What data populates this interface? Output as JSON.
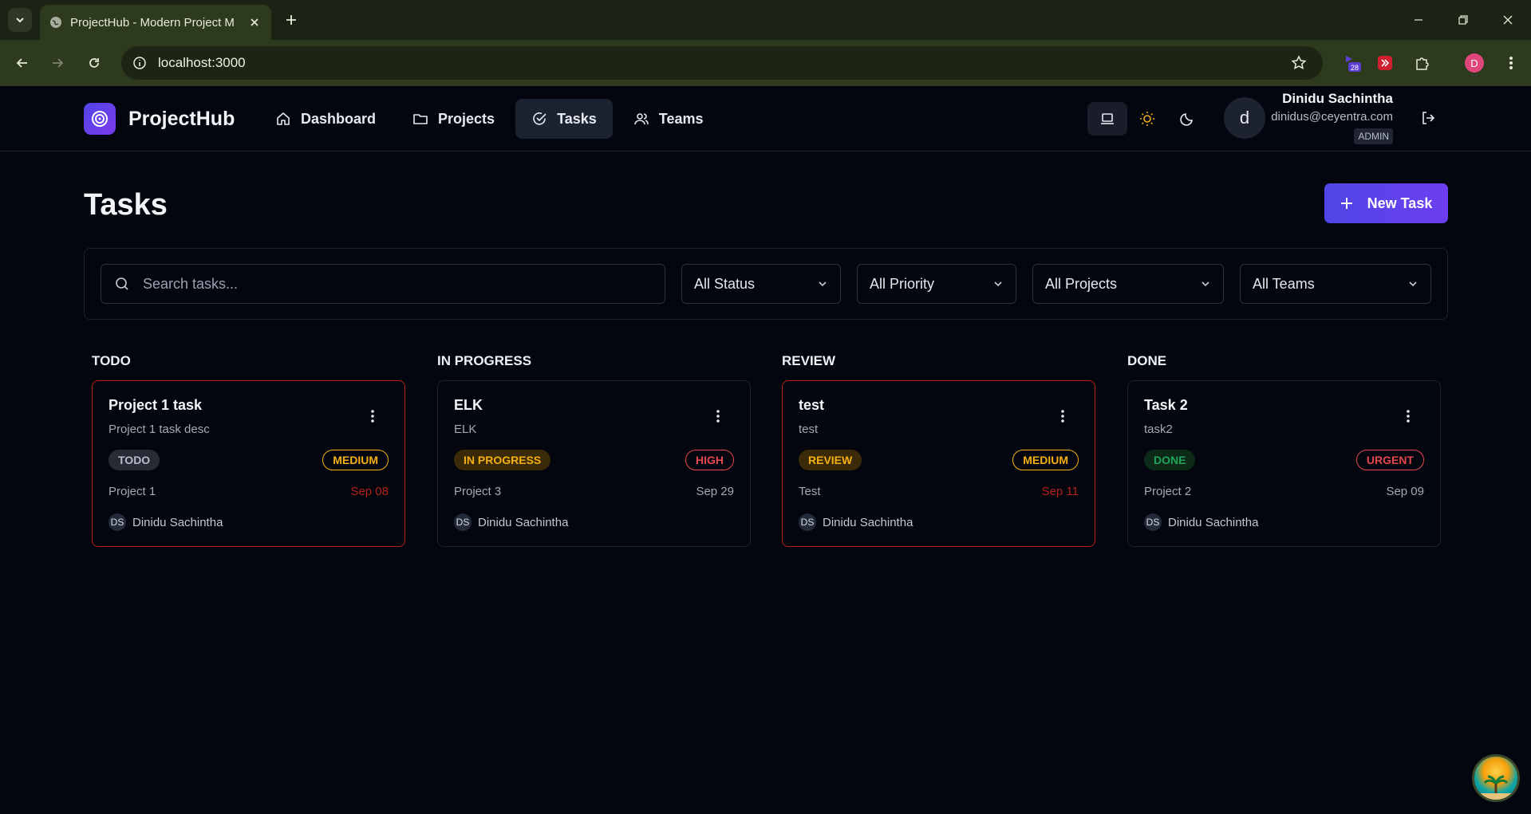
{
  "browser": {
    "tab_title": "ProjectHub - Modern Project M",
    "url": "localhost:3000",
    "extension_badge": "28",
    "profile_initial": "D"
  },
  "app": {
    "brand": "ProjectHub",
    "nav": [
      {
        "label": "Dashboard",
        "icon": "home-icon"
      },
      {
        "label": "Projects",
        "icon": "folder-icon"
      },
      {
        "label": "Tasks",
        "icon": "check-circle-icon",
        "active": true
      },
      {
        "label": "Teams",
        "icon": "users-icon"
      }
    ],
    "user": {
      "initial": "d",
      "name": "Dinidu Sachintha",
      "email": "dinidus@ceyentra.com",
      "role": "ADMIN"
    }
  },
  "page": {
    "title": "Tasks",
    "new_task_label": "New Task"
  },
  "filters": {
    "search_placeholder": "Search tasks...",
    "status": "All Status",
    "priority": "All Priority",
    "project": "All Projects",
    "team": "All Teams"
  },
  "columns": [
    {
      "title": "TODO",
      "cards": [
        {
          "title": "Project 1 task",
          "desc": "Project 1 task desc",
          "status": "TODO",
          "priority": "MEDIUM",
          "project": "Project 1",
          "date": "Sep 08",
          "overdue": true,
          "assignee_initials": "DS",
          "assignee": "Dinidu Sachintha"
        }
      ]
    },
    {
      "title": "IN PROGRESS",
      "cards": [
        {
          "title": "ELK",
          "desc": "ELK",
          "status": "IN PROGRESS",
          "priority": "HIGH",
          "project": "Project 3",
          "date": "Sep 29",
          "overdue": false,
          "assignee_initials": "DS",
          "assignee": "Dinidu Sachintha"
        }
      ]
    },
    {
      "title": "REVIEW",
      "cards": [
        {
          "title": "test",
          "desc": "test",
          "status": "REVIEW",
          "priority": "MEDIUM",
          "project": "Test",
          "date": "Sep 11",
          "overdue": true,
          "assignee_initials": "DS",
          "assignee": "Dinidu Sachintha"
        }
      ]
    },
    {
      "title": "DONE",
      "cards": [
        {
          "title": "Task 2",
          "desc": "task2",
          "status": "DONE",
          "priority": "URGENT",
          "project": "Project 2",
          "date": "Sep 09",
          "overdue": false,
          "assignee_initials": "DS",
          "assignee": "Dinidu Sachintha"
        }
      ]
    }
  ],
  "colors": {
    "accent": "#4f46e5",
    "overdue": "#b42318",
    "medium": "#f5b014",
    "high": "#e5484d",
    "done": "#22a35a"
  }
}
